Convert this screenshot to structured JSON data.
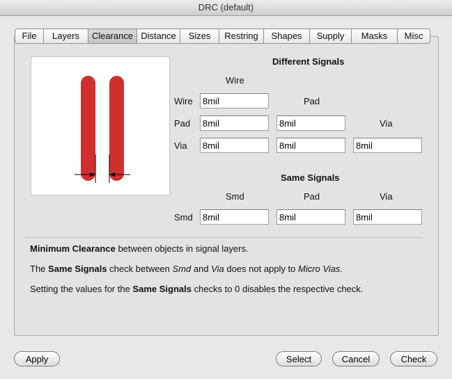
{
  "window": {
    "title": "DRC (default)"
  },
  "tabs": [
    {
      "label": "File"
    },
    {
      "label": "Layers"
    },
    {
      "label": "Clearance"
    },
    {
      "label": "Distance"
    },
    {
      "label": "Sizes"
    },
    {
      "label": "Restring"
    },
    {
      "label": "Shapes"
    },
    {
      "label": "Supply"
    },
    {
      "label": "Masks"
    },
    {
      "label": "Misc"
    }
  ],
  "active_tab": "Clearance",
  "different_signals": {
    "title": "Different Signals",
    "col_wire": "Wire",
    "col_pad": "Pad",
    "col_via": "Via",
    "row_wire": "Wire",
    "row_pad": "Pad",
    "row_via": "Via",
    "wire_wire": "8mil",
    "pad_wire": "8mil",
    "pad_pad": "8mil",
    "via_wire": "8mil",
    "via_pad": "8mil",
    "via_via": "8mil"
  },
  "same_signals": {
    "title": "Same Signals",
    "col_smd": "Smd",
    "col_pad": "Pad",
    "col_via": "Via",
    "row_smd": "Smd",
    "smd_smd": "8mil",
    "smd_pad": "8mil",
    "smd_via": "8mil"
  },
  "info": {
    "line1_b": "Minimum Clearance",
    "line1_rest": " between objects in signal layers.",
    "line2_a": "The ",
    "line2_b": "Same Signals",
    "line2_c": " check between ",
    "line2_i1": "Smd",
    "line2_d": " and ",
    "line2_i2": "Via",
    "line2_e": " does not apply to ",
    "line2_i3": "Micro Vias",
    "line2_f": ".",
    "line3_a": "Setting the values for the ",
    "line3_b": "Same Signals",
    "line3_c": " checks to 0 disables the respective check."
  },
  "buttons": {
    "apply": "Apply",
    "select": "Select",
    "cancel": "Cancel",
    "check": "Check"
  },
  "colors": {
    "trace": "#d0302d"
  }
}
